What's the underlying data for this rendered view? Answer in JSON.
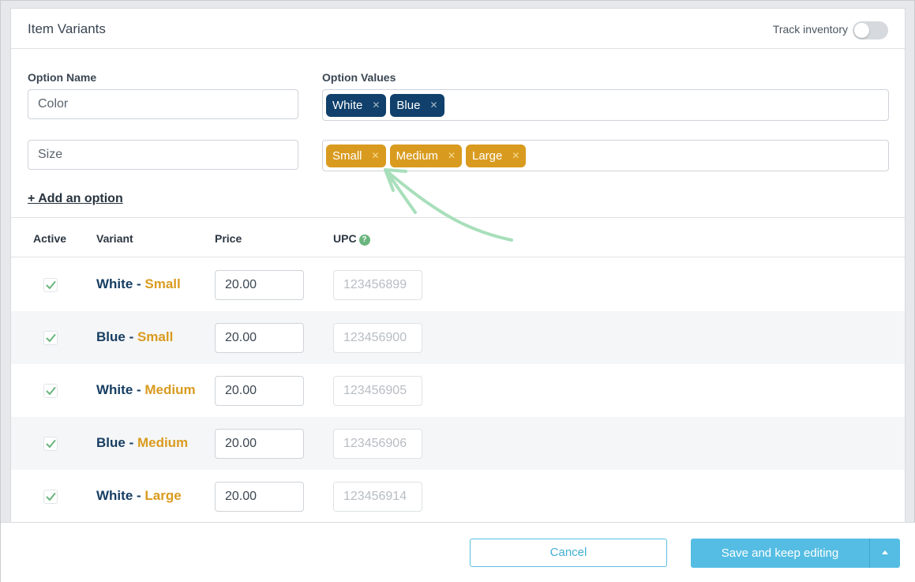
{
  "panel": {
    "title": "Item Variants",
    "track_inventory_label": "Track inventory",
    "track_inventory_on": false
  },
  "options": {
    "name_header": "Option Name",
    "values_header": "Option Values",
    "rows": [
      {
        "name": "Color",
        "values": [
          "White",
          "Blue"
        ]
      },
      {
        "name": "Size",
        "values": [
          "Small",
          "Medium",
          "Large"
        ]
      }
    ],
    "add_option_label": "+ Add an option"
  },
  "table": {
    "headers": {
      "active": "Active",
      "variant": "Variant",
      "price": "Price",
      "upc": "UPC"
    },
    "separator": " - ",
    "rows": [
      {
        "active": true,
        "color": "White",
        "size": "Small",
        "price": "20.00",
        "upc": "123456899"
      },
      {
        "active": true,
        "color": "Blue",
        "size": "Small",
        "price": "20.00",
        "upc": "123456900"
      },
      {
        "active": true,
        "color": "White",
        "size": "Medium",
        "price": "20.00",
        "upc": "123456905"
      },
      {
        "active": true,
        "color": "Blue",
        "size": "Medium",
        "price": "20.00",
        "upc": "123456906"
      },
      {
        "active": true,
        "color": "White",
        "size": "Large",
        "price": "20.00",
        "upc": "123456914"
      }
    ]
  },
  "footer": {
    "cancel_label": "Cancel",
    "save_label": "Save and keep editing"
  },
  "colors": {
    "color_tag": "#10406b",
    "size_tag": "#d99b1f",
    "accent": "#55bde3",
    "check": "#6ab57d",
    "annotation_arrow": "#a8dfbb"
  },
  "icons": {
    "tag_remove": "x-icon",
    "help": "question-icon",
    "check": "checkmark-icon",
    "dropdown": "caret-up-icon"
  }
}
